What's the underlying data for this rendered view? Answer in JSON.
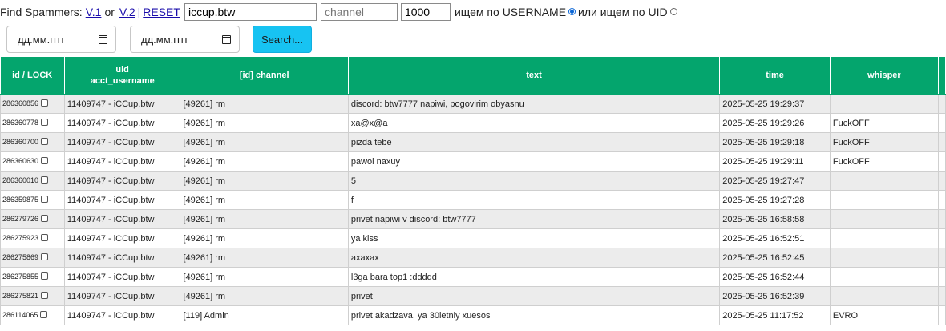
{
  "header": {
    "title_label": "Find Spammers:",
    "v1_link": "V.1",
    "or_text": "or",
    "v2_link": "V.2",
    "separator": "|",
    "reset_link": "RESET",
    "username_value": "iccup.btw",
    "channel_placeholder": "channel",
    "limit_value": "1000",
    "search_by_username_label": "ищем по USERNAME",
    "search_by_uid_label": "или ищем по UID",
    "selected_mode": "username"
  },
  "filters": {
    "date_from_placeholder": "дд.мм.гггг",
    "date_to_placeholder": "дд.мм.гггг",
    "search_button": "Search..."
  },
  "table": {
    "columns": {
      "id_lock": "id / LOCK",
      "uid": "uid",
      "acct_username": "acct_username",
      "channel": "[id] channel",
      "text": "text",
      "time": "time",
      "whisper": "whisper"
    },
    "rows": [
      {
        "id": "286360856",
        "uid": "11409747 - iCCup.btw",
        "channel": "[49261] rm",
        "text": "discord: btw7777 napiwi, pogovirim obyasnu",
        "time": "2025-05-25 19:29:37",
        "whisper": ""
      },
      {
        "id": "286360778",
        "uid": "11409747 - iCCup.btw",
        "channel": "[49261] rm",
        "text": "xa@x@a",
        "time": "2025-05-25 19:29:26",
        "whisper": "FuckOFF"
      },
      {
        "id": "286360700",
        "uid": "11409747 - iCCup.btw",
        "channel": "[49261] rm",
        "text": "pizda tebe",
        "time": "2025-05-25 19:29:18",
        "whisper": "FuckOFF"
      },
      {
        "id": "286360630",
        "uid": "11409747 - iCCup.btw",
        "channel": "[49261] rm",
        "text": "pawol naxuy",
        "time": "2025-05-25 19:29:11",
        "whisper": "FuckOFF"
      },
      {
        "id": "286360010",
        "uid": "11409747 - iCCup.btw",
        "channel": "[49261] rm",
        "text": "5",
        "time": "2025-05-25 19:27:47",
        "whisper": ""
      },
      {
        "id": "286359875",
        "uid": "11409747 - iCCup.btw",
        "channel": "[49261] rm",
        "text": "f",
        "time": "2025-05-25 19:27:28",
        "whisper": ""
      },
      {
        "id": "286279726",
        "uid": "11409747 - iCCup.btw",
        "channel": "[49261] rm",
        "text": "privet napiwi v discord: btw7777",
        "time": "2025-05-25 16:58:58",
        "whisper": ""
      },
      {
        "id": "286275923",
        "uid": "11409747 - iCCup.btw",
        "channel": "[49261] rm",
        "text": "ya kiss",
        "time": "2025-05-25 16:52:51",
        "whisper": ""
      },
      {
        "id": "286275869",
        "uid": "11409747 - iCCup.btw",
        "channel": "[49261] rm",
        "text": "axaxax",
        "time": "2025-05-25 16:52:45",
        "whisper": ""
      },
      {
        "id": "286275855",
        "uid": "11409747 - iCCup.btw",
        "channel": "[49261] rm",
        "text": "l3ga bara top1 :ddddd",
        "time": "2025-05-25 16:52:44",
        "whisper": ""
      },
      {
        "id": "286275821",
        "uid": "11409747 - iCCup.btw",
        "channel": "[49261] rm",
        "text": "privet",
        "time": "2025-05-25 16:52:39",
        "whisper": ""
      },
      {
        "id": "286114065",
        "uid": "11409747 - iCCup.btw",
        "channel": "[119] Admin",
        "text": "privet akadzava, ya 30letniy xuesos",
        "time": "2025-05-25 11:17:52",
        "whisper": "EVRO"
      }
    ]
  },
  "colors": {
    "header_green": "#04a56d",
    "search_button": "#17c3f2",
    "link_blue": "#1a0dab",
    "row_stripe": "#ececec"
  }
}
